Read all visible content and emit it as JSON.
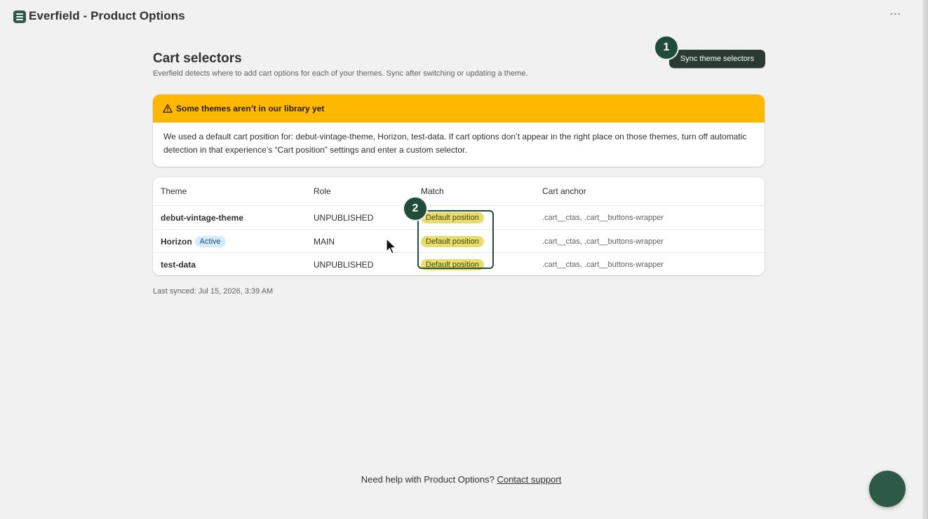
{
  "app": {
    "title": "Everfield - Product Options",
    "icon": "app-logo-icon",
    "more_icon": "more-horizontal-icon"
  },
  "header": {
    "title": "Cart selectors",
    "subtitle": "Everfield detects where to add cart options for each of your themes. Sync after switching or updating a theme.",
    "sync_button": "Sync theme selectors"
  },
  "steps": {
    "one": "1",
    "two": "2"
  },
  "banner": {
    "title": "Some themes aren’t in our library yet",
    "body": "We used a default cart position for: debut-vintage-theme, Horizon, test-data. If cart options don’t appear in the right place on those themes, turn off automatic detection in that experience’s “Cart position” settings and enter a custom selector.",
    "icon": "warning-icon",
    "color": "#ffb800"
  },
  "table": {
    "columns": [
      "Theme",
      "Role",
      "Match",
      "Cart anchor"
    ],
    "rows": [
      {
        "theme": "debut-vintage-theme",
        "badge": "",
        "role": "UNPUBLISHED",
        "match": "Default position",
        "anchor": ".cart__ctas, .cart__buttons-wrapper"
      },
      {
        "theme": "Horizon",
        "badge": "Active",
        "role": "MAIN",
        "match": "Default position",
        "anchor": ".cart__ctas, .cart__buttons-wrapper"
      },
      {
        "theme": "test-data",
        "badge": "",
        "role": "UNPUBLISHED",
        "match": "Default position",
        "anchor": ".cart__ctas, .cart__buttons-wrapper"
      }
    ]
  },
  "last_synced": "Last synced: Jul 15, 2026, 3:39 AM",
  "footer": {
    "help_text": "Need help with Product Options?",
    "link": "Contact support"
  },
  "colors": {
    "brand": "#2c5a46",
    "warning": "#ffb800",
    "match_pill": "#e6dd6f",
    "active_badge": "#d5ebff"
  }
}
